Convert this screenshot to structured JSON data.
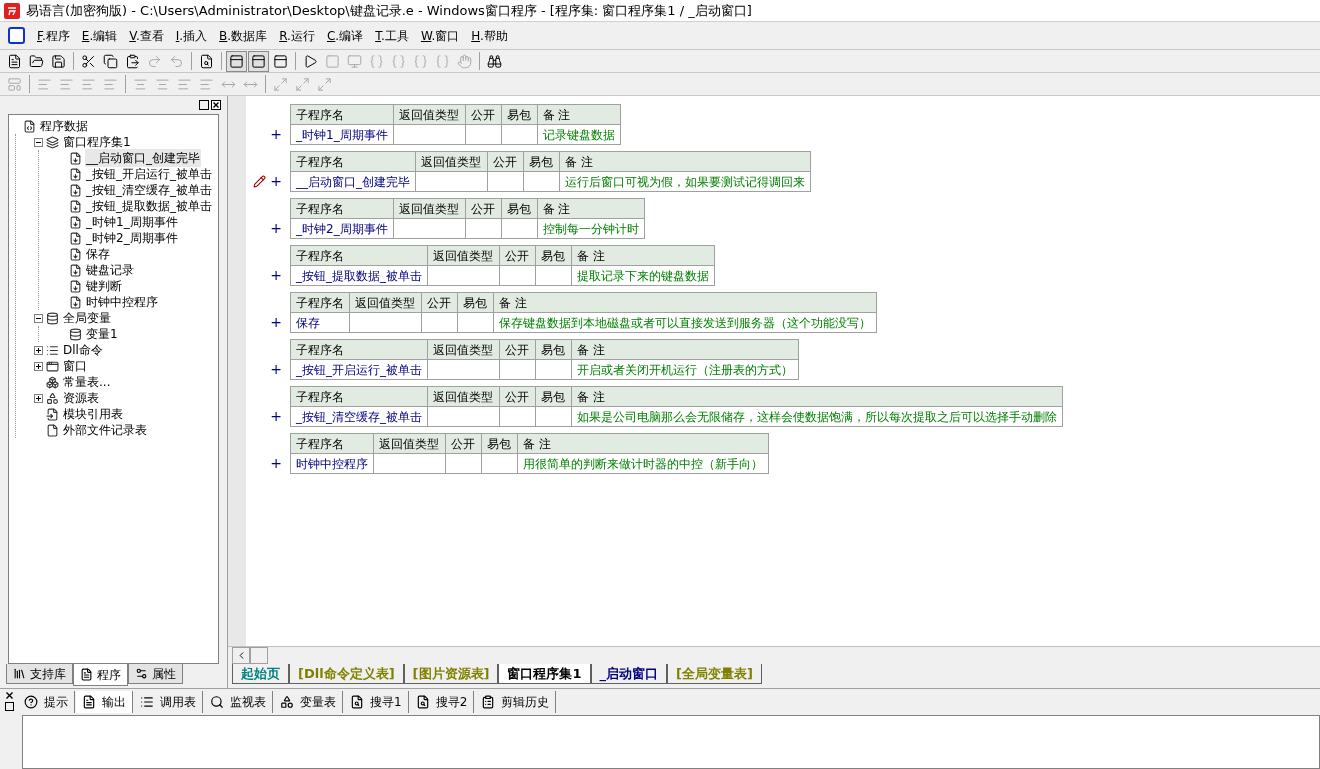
{
  "window": {
    "title": "易语言(加密狗版) - C:\\Users\\Administrator\\Desktop\\键盘记录.e - Windows窗口程序 - [程序集: 窗口程序集1 / _启动窗口]"
  },
  "menu": [
    {
      "key": "F",
      "label": ".程序"
    },
    {
      "key": "E",
      "label": ".编辑"
    },
    {
      "key": "V",
      "label": ".查看"
    },
    {
      "key": "I",
      "label": ".插入"
    },
    {
      "key": "B",
      "label": ".数据库"
    },
    {
      "key": "R",
      "label": ".运行"
    },
    {
      "key": "C",
      "label": ".编译"
    },
    {
      "key": "T",
      "label": ".工具"
    },
    {
      "key": "W",
      "label": ".窗口"
    },
    {
      "key": "H",
      "label": ".帮助"
    }
  ],
  "toolbar_1": [
    {
      "kind": "new",
      "disabled": false,
      "pressed": false
    },
    {
      "kind": "open",
      "disabled": false,
      "pressed": false
    },
    {
      "kind": "save",
      "disabled": false,
      "pressed": false
    },
    {
      "kind": "sep"
    },
    {
      "kind": "cut",
      "disabled": false,
      "pressed": false
    },
    {
      "kind": "copy",
      "disabled": false,
      "pressed": false
    },
    {
      "kind": "paste",
      "disabled": false,
      "pressed": false
    },
    {
      "kind": "redo",
      "disabled": true,
      "pressed": false
    },
    {
      "kind": "undo",
      "disabled": true,
      "pressed": false
    },
    {
      "kind": "sep"
    },
    {
      "kind": "find",
      "disabled": false,
      "pressed": false
    },
    {
      "kind": "sep"
    },
    {
      "kind": "layout",
      "disabled": false,
      "pressed": true
    },
    {
      "kind": "layout",
      "disabled": false,
      "pressed": true
    },
    {
      "kind": "layout",
      "disabled": false,
      "pressed": false
    },
    {
      "kind": "sep"
    },
    {
      "kind": "run",
      "disabled": false,
      "pressed": false
    },
    {
      "kind": "stop",
      "disabled": true,
      "pressed": false
    },
    {
      "kind": "monitor",
      "disabled": true,
      "pressed": false
    },
    {
      "kind": "braces",
      "disabled": true,
      "pressed": false
    },
    {
      "kind": "braces",
      "disabled": true,
      "pressed": false
    },
    {
      "kind": "braces",
      "disabled": true,
      "pressed": false
    },
    {
      "kind": "braces",
      "disabled": true,
      "pressed": false
    },
    {
      "kind": "hand",
      "disabled": true,
      "pressed": false
    },
    {
      "kind": "sep"
    },
    {
      "kind": "binoculars",
      "disabled": false,
      "pressed": false
    }
  ],
  "toolbar_2": [
    {
      "kind": "form",
      "disabled": true,
      "pressed": false
    },
    {
      "kind": "sep"
    },
    {
      "kind": "align",
      "disabled": true,
      "pressed": false
    },
    {
      "kind": "align",
      "disabled": true,
      "pressed": false
    },
    {
      "kind": "align",
      "disabled": true,
      "pressed": false
    },
    {
      "kind": "align",
      "disabled": true,
      "pressed": false
    },
    {
      "kind": "sep"
    },
    {
      "kind": "center",
      "disabled": true,
      "pressed": false
    },
    {
      "kind": "center",
      "disabled": true,
      "pressed": false
    },
    {
      "kind": "align",
      "disabled": true,
      "pressed": false
    },
    {
      "kind": "align",
      "disabled": true,
      "pressed": false
    },
    {
      "kind": "space",
      "disabled": true,
      "pressed": false
    },
    {
      "kind": "space",
      "disabled": true,
      "pressed": false
    },
    {
      "kind": "sep"
    },
    {
      "kind": "size",
      "disabled": true,
      "pressed": false
    },
    {
      "kind": "size",
      "disabled": true,
      "pressed": false
    },
    {
      "kind": "size",
      "disabled": true,
      "pressed": false
    }
  ],
  "tree": [
    {
      "label": "程序数据",
      "kind": "root",
      "selected": false,
      "children": [
        {
          "label": "窗口程序集1",
          "kind": "group",
          "expanded": true,
          "selected": false,
          "children": [
            {
              "label": "__启动窗口_创建完毕",
              "kind": "sub",
              "selected": true
            },
            {
              "label": "_按钮_开启运行_被单击",
              "kind": "sub",
              "selected": false
            },
            {
              "label": "_按钮_清空缓存_被单击",
              "kind": "sub",
              "selected": false
            },
            {
              "label": "_按钮_提取数据_被单击",
              "kind": "sub",
              "selected": false
            },
            {
              "label": "_时钟1_周期事件",
              "kind": "sub",
              "selected": false
            },
            {
              "label": "_时钟2_周期事件",
              "kind": "sub",
              "selected": false
            },
            {
              "label": "保存",
              "kind": "sub",
              "selected": false
            },
            {
              "label": "键盘记录",
              "kind": "sub",
              "selected": false
            },
            {
              "label": "键判断",
              "kind": "sub",
              "selected": false
            },
            {
              "label": "时钟中控程序",
              "kind": "sub",
              "selected": false
            }
          ]
        },
        {
          "label": "全局变量",
          "kind": "var",
          "expanded": true,
          "selected": false,
          "children": [
            {
              "label": "变量1",
              "kind": "var",
              "selected": false
            }
          ]
        },
        {
          "label": "Dll命令",
          "kind": "dll",
          "expanded": false,
          "selected": false
        },
        {
          "label": "窗口",
          "kind": "window",
          "expanded": false,
          "selected": false
        },
        {
          "label": "常量表...",
          "kind": "const",
          "selected": false
        },
        {
          "label": "资源表",
          "kind": "resource",
          "expanded": false,
          "selected": false
        },
        {
          "label": "模块引用表",
          "kind": "module",
          "selected": false
        },
        {
          "label": "外部文件记录表",
          "kind": "file",
          "selected": false
        }
      ]
    }
  ],
  "left_tabs": [
    {
      "label": "支持库",
      "kind": "library",
      "selected": false
    },
    {
      "label": "程序",
      "kind": "program",
      "selected": true
    },
    {
      "label": "属性",
      "kind": "props",
      "selected": false
    }
  ],
  "subs": [
    {
      "header": [
        "子程序名",
        "返回值类型",
        "公开",
        "易包",
        "备 注"
      ],
      "expand": "+",
      "current": false,
      "name": "_时钟1_周期事件",
      "note": "记录键盘数据"
    },
    {
      "header": [
        "子程序名",
        "返回值类型",
        "公开",
        "易包",
        "备 注"
      ],
      "expand": "+",
      "current": true,
      "name": "__启动窗口_创建完毕",
      "note": "运行后窗口可视为假，如果要测试记得调回来"
    },
    {
      "header": [
        "子程序名",
        "返回值类型",
        "公开",
        "易包",
        "备 注"
      ],
      "expand": "+",
      "current": false,
      "name": "_时钟2_周期事件",
      "note": "控制每一分钟计时"
    },
    {
      "header": [
        "子程序名",
        "返回值类型",
        "公开",
        "易包",
        "备 注"
      ],
      "expand": "+",
      "current": false,
      "name": "_按钮_提取数据_被单击",
      "note": "提取记录下来的键盘数据"
    },
    {
      "header": [
        "子程序名",
        "返回值类型",
        "公开",
        "易包",
        "备 注"
      ],
      "expand": "+",
      "current": false,
      "name": "保存",
      "note": "保存键盘数据到本地磁盘或者可以直接发送到服务器（这个功能没写）"
    },
    {
      "header": [
        "子程序名",
        "返回值类型",
        "公开",
        "易包",
        "备 注"
      ],
      "expand": "+",
      "current": false,
      "name": "_按钮_开启运行_被单击",
      "note": "开启或者关闭开机运行（注册表的方式）"
    },
    {
      "header": [
        "子程序名",
        "返回值类型",
        "公开",
        "易包",
        "备 注"
      ],
      "expand": "+",
      "current": false,
      "name": "_按钮_清空缓存_被单击",
      "note": "如果是公司电脑那么会无限储存，这样会使数据饱满，所以每次提取之后可以选择手动删除"
    },
    {
      "header": [
        "子程序名",
        "返回值类型",
        "公开",
        "易包",
        "备 注"
      ],
      "expand": "+",
      "current": false,
      "name": "时钟中控程序",
      "note": "用很简单的判断来做计时器的中控（新手向）"
    }
  ],
  "doc_tabs": [
    {
      "label": "起始页",
      "color": "#008080",
      "selected": false
    },
    {
      "label": "[Dll命令定义表]",
      "color": "#808000",
      "selected": false
    },
    {
      "label": "[图片资源表]",
      "color": "#808000",
      "selected": false
    },
    {
      "label": "窗口程序集1",
      "color": "#000000",
      "selected": true
    },
    {
      "label": "_启动窗口",
      "color": "#000080",
      "selected": false
    },
    {
      "label": "[全局变量表]",
      "color": "#808000",
      "selected": false
    }
  ],
  "output_tabs": [
    {
      "label": "提示",
      "kind": "hint",
      "selected": false
    },
    {
      "label": "输出",
      "kind": "output",
      "selected": true
    },
    {
      "label": "调用表",
      "kind": "calls",
      "selected": false
    },
    {
      "label": "监视表",
      "kind": "watch",
      "selected": false
    },
    {
      "label": "变量表",
      "kind": "vars",
      "selected": false
    },
    {
      "label": "搜寻1",
      "kind": "search",
      "selected": false
    },
    {
      "label": "搜寻2",
      "kind": "search",
      "selected": false
    },
    {
      "label": "剪辑历史",
      "kind": "clip",
      "selected": false
    }
  ]
}
